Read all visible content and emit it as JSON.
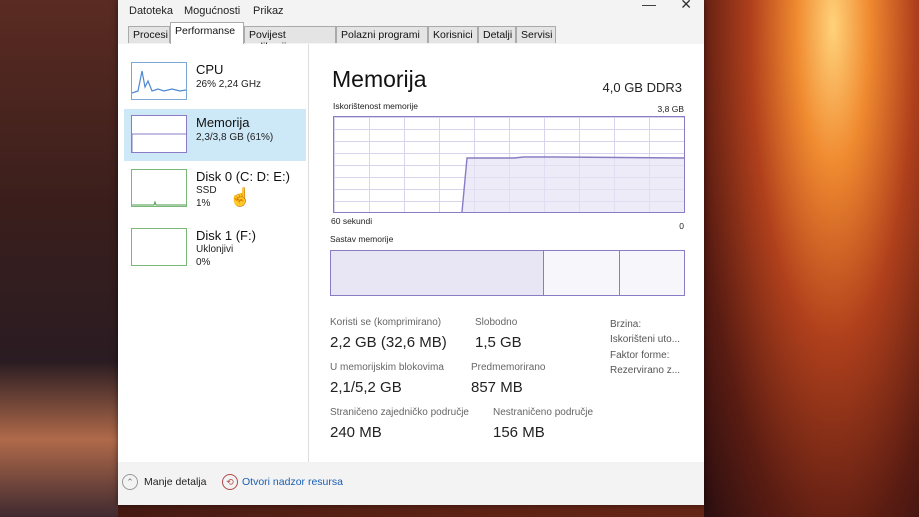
{
  "menu": [
    "Datoteka",
    "Mogućnosti",
    "Prikaz"
  ],
  "tabs": [
    {
      "label": "Procesi",
      "active": false
    },
    {
      "label": "Performanse",
      "active": true
    },
    {
      "label": "Povijest aplikacije",
      "active": false
    },
    {
      "label": "Polazni programi",
      "active": false
    },
    {
      "label": "Korisnici",
      "active": false
    },
    {
      "label": "Detalji",
      "active": false
    },
    {
      "label": "Servisi",
      "active": false
    }
  ],
  "sidebar": {
    "items": [
      {
        "title": "CPU",
        "sub1": "26% 2,24 GHz",
        "sub2": ""
      },
      {
        "title": "Memorija",
        "sub1": "2,3/3,8 GB (61%)",
        "sub2": ""
      },
      {
        "title": "Disk 0 (C: D: E:)",
        "sub1": "SSD",
        "sub2": "1%"
      },
      {
        "title": "Disk 1 (F:)",
        "sub1": "Uklonjivi",
        "sub2": "0%"
      }
    ]
  },
  "main": {
    "title": "Memorija",
    "type": "4,0 GB DDR3",
    "usage_label": "Iskorištenost memorije",
    "usage_max": "3,8 GB",
    "time_label": "60 sekundi",
    "zero_label": "0",
    "composition_label": "Sastav memorije",
    "stats": {
      "in_use_label": "Koristi se (komprimirano)",
      "in_use_value": "2,2 GB (32,6 MB)",
      "available_label": "Slobodno",
      "available_value": "1,5 GB",
      "committed_label": "U memorijskim blokovima",
      "committed_value": "2,1/5,2 GB",
      "cached_label": "Predmemorirano",
      "cached_value": "857 MB",
      "paged_label": "Straničeno zajedničko područje",
      "paged_value": "240 MB",
      "nonpaged_label": "Nestraničeno područje",
      "nonpaged_value": "156 MB"
    },
    "right_labels": {
      "speed": "Brzina:",
      "slots": "Iskorišteni uto...",
      "form_factor": "Faktor forme:",
      "reserved": "Rezervirano z..."
    }
  },
  "footer": {
    "fewer_details": "Manje detalja",
    "resource_monitor": "Otvori nadzor resursa"
  },
  "colors": {
    "accent": "#8a7cc4",
    "selected": "#cde8f7",
    "link": "#1a5fb4"
  }
}
